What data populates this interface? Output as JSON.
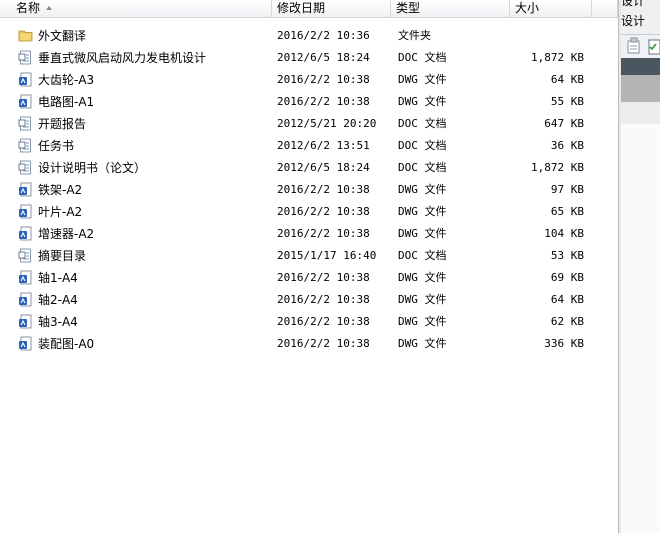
{
  "columns": {
    "name": "名称",
    "date": "修改日期",
    "type": "类型",
    "size": "大小"
  },
  "files": [
    {
      "icon": "folder-icon",
      "name": "外文翻译",
      "date": "2016/2/2 10:36",
      "type": "文件夹",
      "size": ""
    },
    {
      "icon": "doc-file-icon",
      "name": "垂直式微风启动风力发电机设计",
      "date": "2012/6/5 18:24",
      "type": "DOC 文档",
      "size": "1,872 KB"
    },
    {
      "icon": "dwg-file-icon",
      "name": "大齿轮-A3",
      "date": "2016/2/2 10:38",
      "type": "DWG 文件",
      "size": "64 KB"
    },
    {
      "icon": "dwg-file-icon",
      "name": "电路图-A1",
      "date": "2016/2/2 10:38",
      "type": "DWG 文件",
      "size": "55 KB"
    },
    {
      "icon": "doc-file-icon",
      "name": "开题报告",
      "date": "2012/5/21 20:20",
      "type": "DOC 文档",
      "size": "647 KB"
    },
    {
      "icon": "doc-file-icon",
      "name": "任务书",
      "date": "2012/6/2 13:51",
      "type": "DOC 文档",
      "size": "36 KB"
    },
    {
      "icon": "doc-file-icon",
      "name": "设计说明书（论文）",
      "date": "2012/6/5 18:24",
      "type": "DOC 文档",
      "size": "1,872 KB"
    },
    {
      "icon": "dwg-file-icon",
      "name": "铁架-A2",
      "date": "2016/2/2 10:38",
      "type": "DWG 文件",
      "size": "97 KB"
    },
    {
      "icon": "dwg-file-icon",
      "name": "叶片-A2",
      "date": "2016/2/2 10:38",
      "type": "DWG 文件",
      "size": "65 KB"
    },
    {
      "icon": "dwg-file-icon",
      "name": "增速器-A2",
      "date": "2016/2/2 10:38",
      "type": "DWG 文件",
      "size": "104 KB"
    },
    {
      "icon": "doc-file-icon",
      "name": "摘要目录",
      "date": "2015/1/17 16:40",
      "type": "DOC 文档",
      "size": "53 KB"
    },
    {
      "icon": "dwg-file-icon",
      "name": "轴1-A4",
      "date": "2016/2/2 10:38",
      "type": "DWG 文件",
      "size": "69 KB"
    },
    {
      "icon": "dwg-file-icon",
      "name": "轴2-A4",
      "date": "2016/2/2 10:38",
      "type": "DWG 文件",
      "size": "64 KB"
    },
    {
      "icon": "dwg-file-icon",
      "name": "轴3-A4",
      "date": "2016/2/2 10:38",
      "type": "DWG 文件",
      "size": "62 KB"
    },
    {
      "icon": "dwg-file-icon",
      "name": "装配图-A0",
      "date": "2016/2/2 10:38",
      "type": "DWG 文件",
      "size": "336 KB"
    }
  ],
  "side_panel": {
    "line1": "设计",
    "line2": "设计"
  },
  "colors": {
    "folder": "#e8c24a",
    "dwg_blue": "#2a63b8",
    "doc_gray": "#7a8ea8",
    "side_dark": "#4a5660"
  }
}
